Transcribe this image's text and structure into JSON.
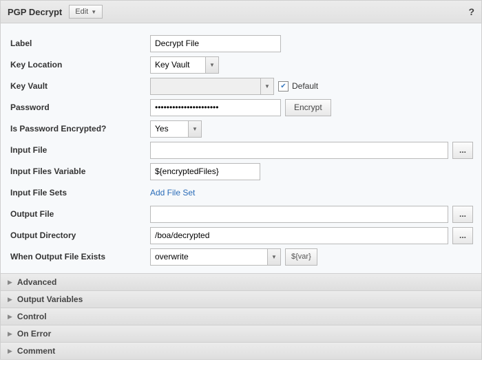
{
  "header": {
    "title": "PGP Decrypt",
    "edit_label": "Edit",
    "help": "?"
  },
  "form": {
    "label": {
      "label": "Label",
      "value": "Decrypt File"
    },
    "key_location": {
      "label": "Key Location",
      "value": "Key Vault"
    },
    "key_vault": {
      "label": "Key Vault",
      "value": "",
      "default_label": "Default",
      "default_checked": true
    },
    "password": {
      "label": "Password",
      "value": "••••••••••••••••••••••",
      "encrypt_button": "Encrypt"
    },
    "is_encrypted": {
      "label": "Is Password Encrypted?",
      "value": "Yes"
    },
    "input_file": {
      "label": "Input File",
      "value": "",
      "browse": "..."
    },
    "input_files_var": {
      "label": "Input Files Variable",
      "value": "${encryptedFiles}"
    },
    "input_file_sets": {
      "label": "Input File Sets",
      "link": "Add File Set"
    },
    "output_file": {
      "label": "Output File",
      "value": "",
      "browse": "..."
    },
    "output_dir": {
      "label": "Output Directory",
      "value": "/boa/decrypted",
      "browse": "..."
    },
    "when_exists": {
      "label": "When Output File Exists",
      "value": "overwrite",
      "var_button": "${var}"
    }
  },
  "sections": {
    "advanced": "Advanced",
    "output_vars": "Output Variables",
    "control": "Control",
    "on_error": "On Error",
    "comment": "Comment"
  }
}
